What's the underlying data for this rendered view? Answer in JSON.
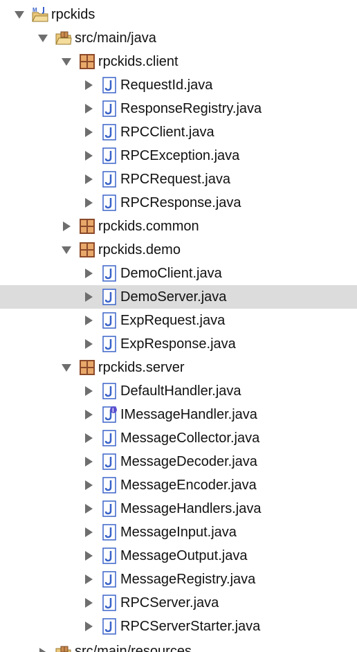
{
  "colors": {
    "text": "#111111",
    "twisty": "#6e6e6e",
    "selection": "#dcdcdc",
    "package_brown": "#8b4a2b",
    "package_fill": "#e8a86a",
    "java_file": "#3a63c9",
    "interface_badge": "#5a4fcf"
  },
  "tree": {
    "project": {
      "label": "rpckids",
      "icon": "java-project-icon",
      "expanded": true
    },
    "source_folder": {
      "label": "src/main/java",
      "icon": "source-folder-icon",
      "expanded": true
    },
    "packages": [
      {
        "label": "rpckids.client",
        "expanded": true,
        "files": [
          {
            "label": "RequestId.java"
          },
          {
            "label": "ResponseRegistry.java"
          },
          {
            "label": "RPCClient.java"
          },
          {
            "label": "RPCException.java"
          },
          {
            "label": "RPCRequest.java"
          },
          {
            "label": "RPCResponse.java"
          }
        ]
      },
      {
        "label": "rpckids.common",
        "expanded": false,
        "files": []
      },
      {
        "label": "rpckids.demo",
        "expanded": true,
        "files": [
          {
            "label": "DemoClient.java"
          },
          {
            "label": "DemoServer.java",
            "selected": true
          },
          {
            "label": "ExpRequest.java"
          },
          {
            "label": "ExpResponse.java"
          }
        ]
      },
      {
        "label": "rpckids.server",
        "expanded": true,
        "files": [
          {
            "label": "DefaultHandler.java"
          },
          {
            "label": "IMessageHandler.java",
            "badge": "interface"
          },
          {
            "label": "MessageCollector.java"
          },
          {
            "label": "MessageDecoder.java"
          },
          {
            "label": "MessageEncoder.java"
          },
          {
            "label": "MessageHandlers.java"
          },
          {
            "label": "MessageInput.java"
          },
          {
            "label": "MessageOutput.java"
          },
          {
            "label": "MessageRegistry.java"
          },
          {
            "label": "RPCServer.java"
          },
          {
            "label": "RPCServerStarter.java"
          }
        ]
      }
    ],
    "next_source_folder": {
      "label": "src/main/resources",
      "icon": "source-folder-icon",
      "partially_visible": true
    }
  }
}
